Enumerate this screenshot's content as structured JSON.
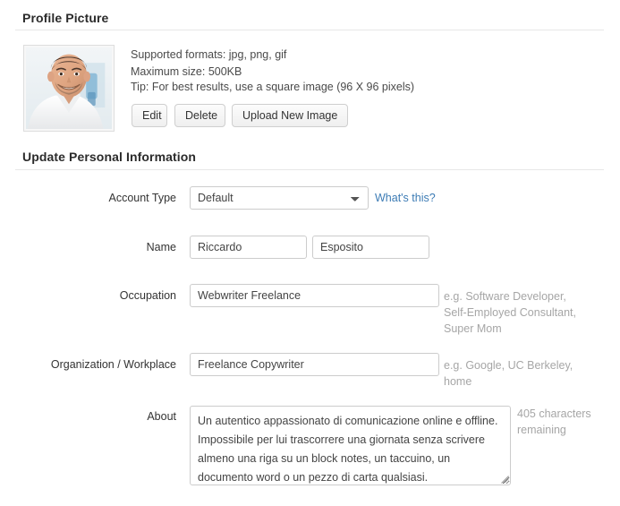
{
  "profile_picture": {
    "section_title": "Profile Picture",
    "avatar_alt": "profile-photo-smiling-man-white-shirt",
    "info_lines": [
      "Supported formats: jpg, png, gif",
      "Maximum size: 500KB",
      "Tip: For best results, use a square image (96 X 96 pixels)"
    ],
    "buttons": [
      {
        "label": "Edit",
        "name": "edit-button"
      },
      {
        "label": "Delete",
        "name": "delete-button"
      },
      {
        "label": "Upload New Image",
        "name": "upload-new-image-button"
      }
    ]
  },
  "personal_info": {
    "section_title": "Update Personal Information",
    "account_type": {
      "label": "Account Type",
      "value": "Default",
      "options": [
        "Default"
      ],
      "help_link": "What's this?"
    },
    "name": {
      "label": "Name",
      "first_value": "Riccardo",
      "last_value": "Esposito",
      "first_placeholder": "",
      "last_placeholder": ""
    },
    "occupation": {
      "label": "Occupation",
      "value": "Webwriter Freelance",
      "placeholder": "",
      "hint": "e.g. Software Developer, Self-Employed Consultant, Super Mom",
      "hint_overflow": "Mom"
    },
    "organization": {
      "label": "Organization / Workplace",
      "value": "Freelance Copywriter",
      "placeholder": "",
      "hint": "e.g. Google, UC Berkeley, home"
    },
    "about": {
      "label": "About",
      "value": "Un autentico appassionato di comunicazione online e offline. Impossibile per lui trascorrere una giornata senza scrivere almeno una riga su un block notes, un taccuino, un documento word o un pezzo di carta qualsiasi.",
      "placeholder": "",
      "counter": "405 characters remaining"
    }
  },
  "colors": {
    "link": "#3d7cb5",
    "hint_text": "#a6a6a6",
    "border": "#cccccc",
    "divider": "#e8e8e8",
    "heading": "#2b2b2b"
  }
}
